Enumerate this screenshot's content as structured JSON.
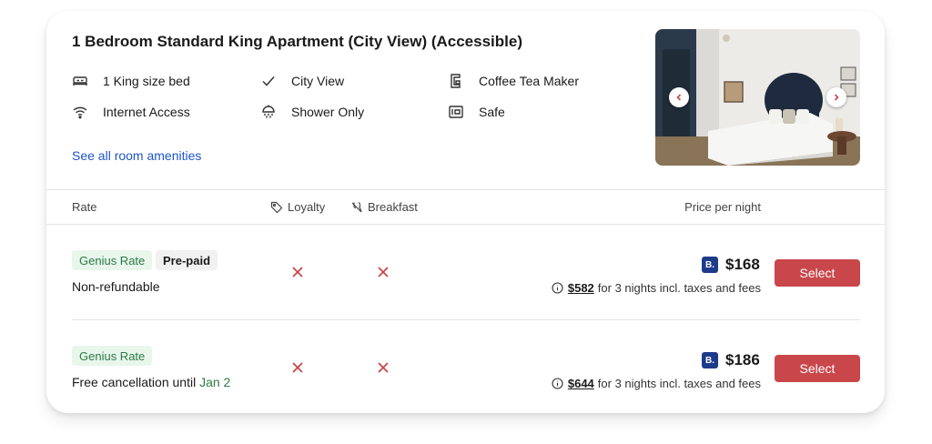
{
  "room": {
    "title": "1 Bedroom Standard King Apartment (City View) (Accessible)",
    "amenities": [
      {
        "icon": "bed-icon",
        "label": "1 King size bed"
      },
      {
        "icon": "checkmark-icon",
        "label": "City View"
      },
      {
        "icon": "coffee-maker-icon",
        "label": "Coffee Tea Maker"
      },
      {
        "icon": "wifi-icon",
        "label": "Internet Access"
      },
      {
        "icon": "shower-icon",
        "label": "Shower Only"
      },
      {
        "icon": "safe-icon",
        "label": "Safe"
      }
    ],
    "see_all_label": "See all room amenities",
    "photo": {
      "prev_icon": "chevron-left-icon",
      "next_icon": "chevron-right-icon"
    }
  },
  "table": {
    "headers": {
      "rate": "Rate",
      "loyalty": "Loyalty",
      "breakfast": "Breakfast",
      "price": "Price per night"
    },
    "rates": [
      {
        "badges": [
          "Genius Rate",
          "Pre-paid"
        ],
        "condition": "Non-refundable",
        "condition_date": "",
        "loyalty": "x-icon",
        "breakfast": "x-icon",
        "brand_logo": "B.",
        "price": "$168",
        "total_amount": "$582",
        "total_text": "for 3 nights incl. taxes and fees",
        "select_label": "Select"
      },
      {
        "badges": [
          "Genius Rate"
        ],
        "condition": "Free cancellation until",
        "condition_date": "Jan 2",
        "loyalty": "x-icon",
        "breakfast": "x-icon",
        "brand_logo": "B.",
        "price": "$186",
        "total_amount": "$644",
        "total_text": "for 3 nights incl. taxes and fees",
        "select_label": "Select"
      }
    ]
  },
  "colors": {
    "accent_button": "#c9474b",
    "link": "#1f54c7",
    "genius_bg": "#e8f6ec",
    "genius_text": "#2d7a44",
    "brand_logo_bg": "#1e3a8a",
    "x_mark": "#c9474b"
  }
}
